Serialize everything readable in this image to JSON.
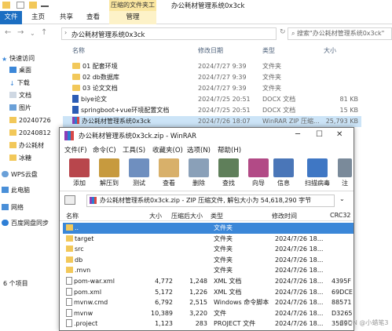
{
  "explorer": {
    "window_title": "办公耗材管理系统0x3ck",
    "context_tab": "压缩的文件夹工具",
    "ribbon_tabs": [
      "文件",
      "主页",
      "共享",
      "查看",
      "管理"
    ],
    "address_path": "办公耗材管理系统0x3ck",
    "search_placeholder": "搜索\"办公耗材管理系统0x3ck\"",
    "columns": {
      "name": "名称",
      "date": "修改日期",
      "type": "类型",
      "size": "大小"
    },
    "sidebar": [
      {
        "label": "快速访问",
        "icon": "star-icon"
      },
      {
        "label": "桌面",
        "icon": "desktop-icon"
      },
      {
        "label": "下载",
        "icon": "download-icon"
      },
      {
        "label": "文档",
        "icon": "document-icon"
      },
      {
        "label": "图片",
        "icon": "picture-icon"
      },
      {
        "label": "20240726",
        "icon": "folder-icon"
      },
      {
        "label": "20240812",
        "icon": "folder-icon"
      },
      {
        "label": "办公耗材",
        "icon": "folder-icon"
      },
      {
        "label": "冰糖",
        "icon": "folder-icon"
      },
      {
        "label": "WPS云盘",
        "icon": "cloud-icon"
      },
      {
        "label": "此电脑",
        "icon": "computer-icon"
      },
      {
        "label": "网络",
        "icon": "network-icon"
      },
      {
        "label": "百度网盘同步",
        "icon": "cloud-icon"
      }
    ],
    "files": [
      {
        "name": "01 配套环境",
        "date": "2024/7/27 9:39",
        "type": "文件夹",
        "size": "",
        "icon": "folder-icon"
      },
      {
        "name": "02 db数据库",
        "date": "2024/7/27 9:39",
        "type": "文件夹",
        "size": "",
        "icon": "folder-icon"
      },
      {
        "name": "03 论文文档",
        "date": "2024/7/27 9:39",
        "type": "文件夹",
        "size": "",
        "icon": "folder-icon"
      },
      {
        "name": "biye论文",
        "date": "2024/7/25 20:51",
        "type": "DOCX 文档",
        "size": "81 KB",
        "icon": "docx-icon"
      },
      {
        "name": "springboot+vue环境配置文档",
        "date": "2024/7/25 20:51",
        "type": "DOCX 文档",
        "size": "15 KB",
        "icon": "docx-icon"
      },
      {
        "name": "办公耗材管理系统0x3ck",
        "date": "2024/7/26 18:07",
        "type": "WinRAR ZIP 压缩...",
        "size": "25,793 KB",
        "icon": "zip-icon"
      }
    ],
    "status": "6 个项目"
  },
  "winrar": {
    "title": "办公耗材管理系统0x3ck.zip - WinRAR",
    "menu": [
      "文件(F)",
      "命令(C)",
      "工具(S)",
      "收藏夹(O)",
      "选项(N)",
      "帮助(H)"
    ],
    "tools": [
      {
        "label": "添加",
        "icon": "add-archive-icon",
        "color": "#b8464c"
      },
      {
        "label": "解压到",
        "icon": "extract-to-icon",
        "color": "#c79a3e"
      },
      {
        "label": "测试",
        "icon": "test-icon",
        "color": "#6f8fbf"
      },
      {
        "label": "查看",
        "icon": "view-icon",
        "color": "#d8b06a"
      },
      {
        "label": "删除",
        "icon": "delete-icon",
        "color": "#8aa0b8"
      },
      {
        "label": "查找",
        "icon": "find-icon",
        "color": "#5f7f5a"
      },
      {
        "label": "向导",
        "icon": "wizard-icon",
        "color": "#b24a86"
      },
      {
        "label": "信息",
        "icon": "info-icon",
        "color": "#4a76b8"
      },
      {
        "label": "扫描病毒",
        "icon": "scan-virus-icon",
        "color": "#3f77c4"
      },
      {
        "label": "注",
        "icon": "comment-icon",
        "color": "#7a8a9a"
      }
    ],
    "path": "办公耗材管理系统0x3ck.zip - ZIP 压缩文件, 解包大小为 54,618,290 字节",
    "columns": {
      "name": "名称",
      "size": "大小",
      "packed": "压缩后大小",
      "type": "类型",
      "modified": "修改时间",
      "crc": "CRC32"
    },
    "rows": [
      {
        "name": "..",
        "size": "",
        "packed": "",
        "type": "文件夹",
        "modified": "",
        "crc": "",
        "kind": "folder"
      },
      {
        "name": "target",
        "size": "",
        "packed": "",
        "type": "文件夹",
        "modified": "2024/7/26 18...",
        "crc": "",
        "kind": "folder"
      },
      {
        "name": "src",
        "size": "",
        "packed": "",
        "type": "文件夹",
        "modified": "2024/7/26 18...",
        "crc": "",
        "kind": "folder"
      },
      {
        "name": "db",
        "size": "",
        "packed": "",
        "type": "文件夹",
        "modified": "2024/7/26 18...",
        "crc": "",
        "kind": "folder"
      },
      {
        "name": ".mvn",
        "size": "",
        "packed": "",
        "type": "文件夹",
        "modified": "2024/7/26 18...",
        "crc": "",
        "kind": "folder"
      },
      {
        "name": "pom-war.xml",
        "size": "4,772",
        "packed": "1,248",
        "type": "XML 文档",
        "modified": "2024/7/26 18...",
        "crc": "4395F",
        "kind": "file"
      },
      {
        "name": "pom.xml",
        "size": "5,172",
        "packed": "1,226",
        "type": "XML 文档",
        "modified": "2024/7/26 18...",
        "crc": "69DCE",
        "kind": "file"
      },
      {
        "name": "mvnw.cmd",
        "size": "6,792",
        "packed": "2,515",
        "type": "Windows 命令脚本",
        "modified": "2024/7/26 18...",
        "crc": "88571",
        "kind": "file"
      },
      {
        "name": "mvnw",
        "size": "10,389",
        "packed": "3,220",
        "type": "文件",
        "modified": "2024/7/26 18...",
        "crc": "D3265",
        "kind": "file"
      },
      {
        "name": ".project",
        "size": "1,123",
        "packed": "283",
        "type": "PROJECT 文件",
        "modified": "2024/7/26 18...",
        "crc": "35B9C",
        "kind": "file"
      }
    ]
  },
  "watermark": "CSDN @小蜡笔3"
}
